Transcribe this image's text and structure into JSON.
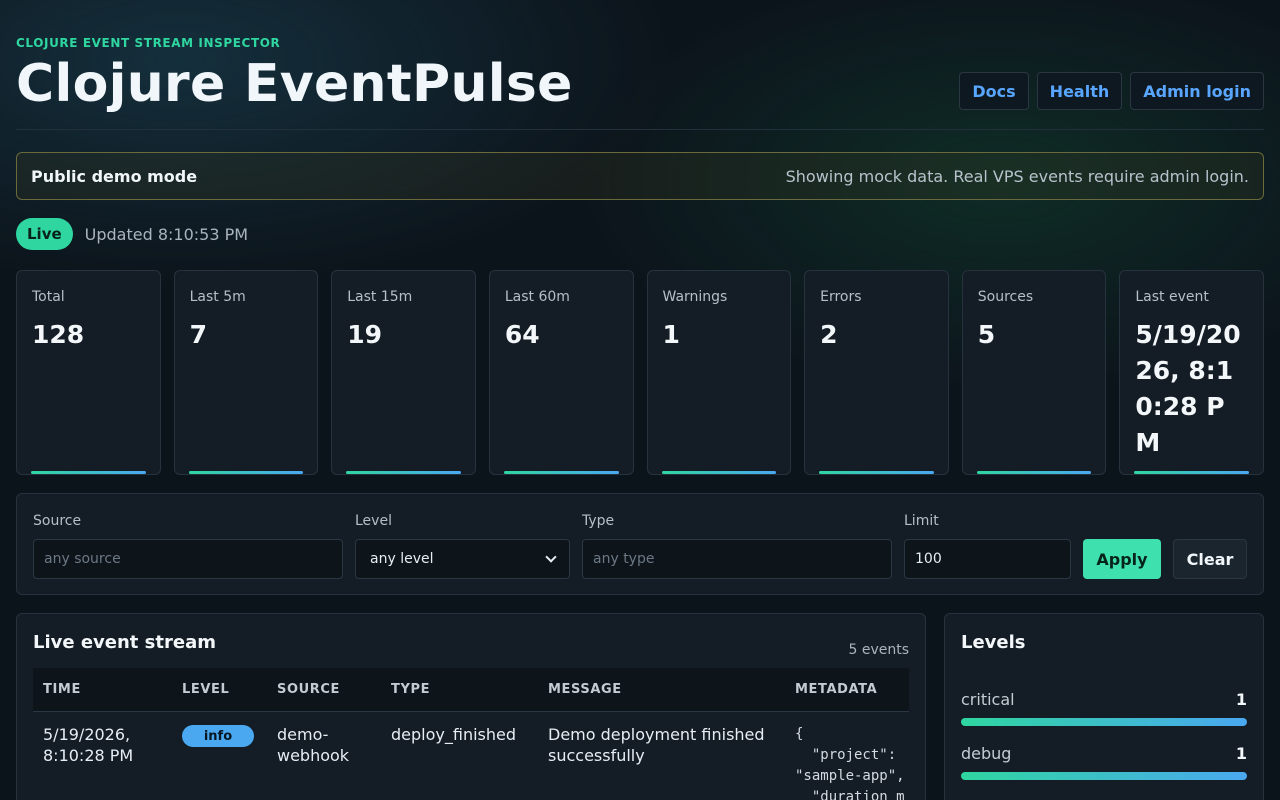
{
  "header": {
    "eyebrow": "CLOJURE EVENT STREAM INSPECTOR",
    "title": "Clojure EventPulse",
    "nav": {
      "docs": "Docs",
      "health": "Health",
      "admin": "Admin login"
    }
  },
  "banner": {
    "title": "Public demo mode",
    "message": "Showing mock data. Real VPS events require admin login."
  },
  "status": {
    "live": "Live",
    "updated": "Updated 8:10:53 PM"
  },
  "stats": [
    {
      "label": "Total",
      "value": "128"
    },
    {
      "label": "Last 5m",
      "value": "7"
    },
    {
      "label": "Last 15m",
      "value": "19"
    },
    {
      "label": "Last 60m",
      "value": "64"
    },
    {
      "label": "Warnings",
      "value": "1"
    },
    {
      "label": "Errors",
      "value": "2"
    },
    {
      "label": "Sources",
      "value": "5"
    },
    {
      "label": "Last event",
      "value": "5/19/2026, 8:10:28 PM"
    }
  ],
  "filters": {
    "source": {
      "label": "Source",
      "placeholder": "any source"
    },
    "level": {
      "label": "Level",
      "value": "any level"
    },
    "type": {
      "label": "Type",
      "placeholder": "any type"
    },
    "limit": {
      "label": "Limit",
      "value": "100"
    },
    "apply": "Apply",
    "clear": "Clear"
  },
  "stream": {
    "title": "Live event stream",
    "count": "5 events",
    "columns": [
      "TIME",
      "LEVEL",
      "SOURCE",
      "TYPE",
      "MESSAGE",
      "METADATA"
    ],
    "rows": [
      {
        "time_line1": "5/19/2026,",
        "time_line2": "8:10:28 PM",
        "level": "info",
        "source_line1": "demo-",
        "source_line2": "webhook",
        "type": "deploy_finished",
        "message_line1": "Demo deployment finished",
        "message_line2": "successfully",
        "metadata": "{\n  \"project\":\n\"sample-app\",\n  \"duration_m"
      }
    ]
  },
  "levels": {
    "title": "Levels",
    "items": [
      {
        "name": "critical",
        "count": "1",
        "fraction": 1.0
      },
      {
        "name": "debug",
        "count": "1",
        "fraction": 1.0
      }
    ]
  },
  "colors": {
    "accent": "#2fd6a0",
    "link": "#58a6ff",
    "info": "#4aa8f0"
  }
}
